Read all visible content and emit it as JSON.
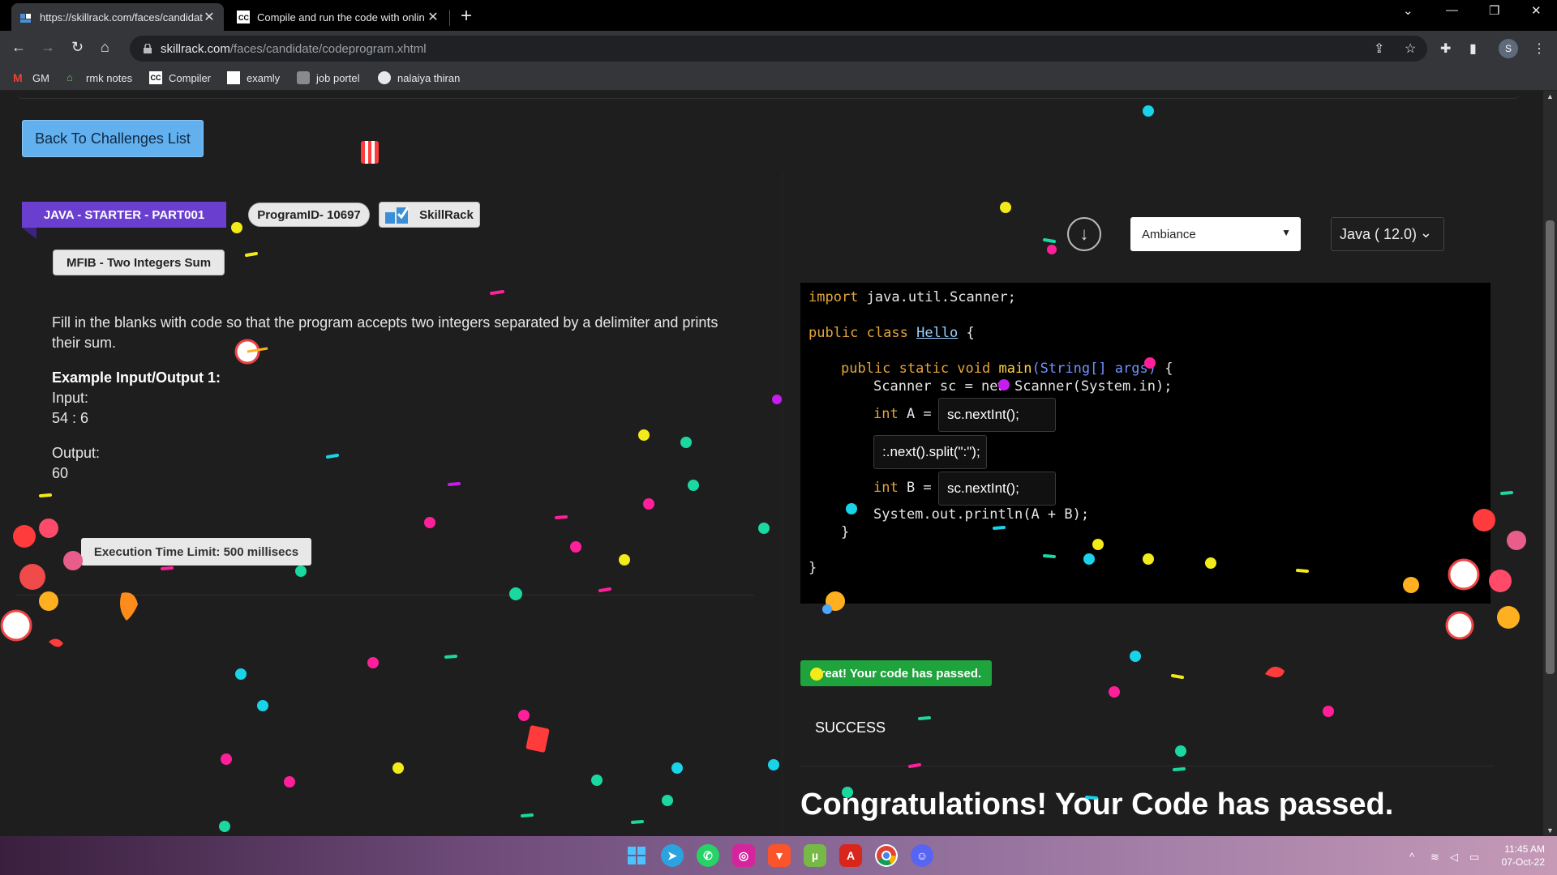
{
  "browser": {
    "tabs": [
      {
        "title": "https://skillrack.com/faces/candidat",
        "active": true
      },
      {
        "title": "Compile and run the code with onlin",
        "active": false
      }
    ],
    "address": {
      "host": "skillrack.com",
      "path": "/faces/candidate/codeprogram.xhtml"
    },
    "bookmarks": [
      "GM",
      "rmk notes",
      "Compiler",
      "examly",
      "job portel",
      "nalaiya thiran"
    ],
    "profile_initial": "S"
  },
  "left_panel": {
    "back_button": "Back To Challenges List",
    "ribbon": "JAVA - STARTER - PART001",
    "program_id": "ProgramID- 10697",
    "brand": "SkillRack",
    "problem_title": "MFIB - Two Integers Sum",
    "description": "Fill in the blanks with code so that the program accepts two integers separated by a delimiter and prints their sum.",
    "example_heading": "Example Input/Output 1:",
    "input_label": "Input:",
    "input_value": "54 : 6",
    "output_label": "Output:",
    "output_value": "60",
    "exec_limit": "Execution Time Limit: 500 millisecs"
  },
  "right_panel": {
    "theme": "Ambiance",
    "language": "Java ( 12.0)",
    "code": {
      "l1_kw": "import",
      "l1_rest": " java.util.Scanner;",
      "l2_kw": "public class",
      "l2_cls": "Hello",
      "l2_rest": " {",
      "l3_kw": "public static void",
      "l3_fn": "main",
      "l3_args": "(String[] args)",
      "l3_rest": " {",
      "l4": "Scanner sc = new Scanner(System.in);",
      "l5_kw": "int",
      "l5_rest": " A =",
      "blank1": "sc.nextInt();",
      "blank2": "sc.next().split(\":\");",
      "blank2_visible": ":.next().split(\":\");",
      "l7_kw": "int",
      "l7_rest": " B =",
      "blank3": "sc.nextInt();",
      "l8": "System.out.println(A + B);",
      "l9": "}",
      "l10": "}"
    },
    "pass_badge": "Great! Your code has passed.",
    "status": "SUCCESS",
    "congrats": "Congratulations! Your Code has passed."
  },
  "taskbar": {
    "time": "11:45 AM",
    "date": "07-Oct-22"
  },
  "colors": {
    "back_button": "#63b0ef",
    "ribbon": "#6a3fd0",
    "pass_badge": "#1ea33d",
    "page_bg": "#1e1e1e",
    "editor_bg": "#000000"
  }
}
